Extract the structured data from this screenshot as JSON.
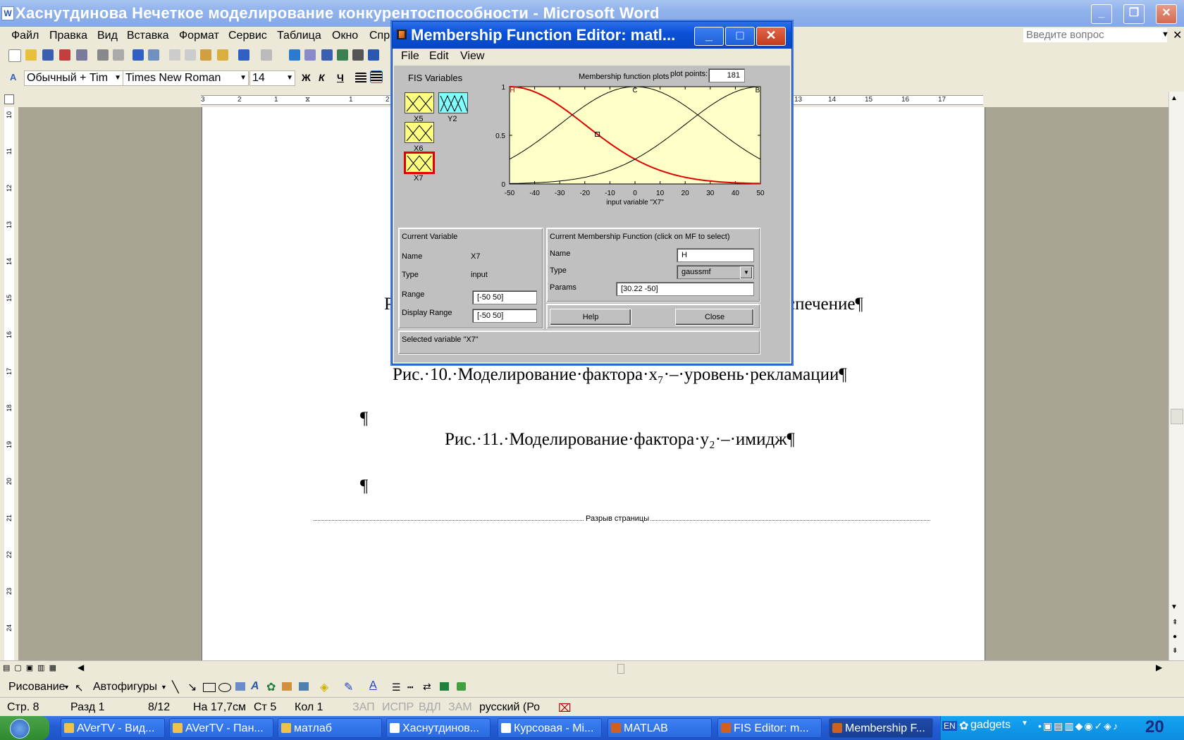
{
  "word": {
    "title": "Хаснутдинова Нечеткое моделирование конкурентоспособности - Microsoft Word",
    "menu": [
      "Файл",
      "Правка",
      "Вид",
      "Вставка",
      "Формат",
      "Сервис",
      "Таблица",
      "Окно",
      "Спра"
    ],
    "ask_placeholder": "Введите вопрос",
    "style_combo": "Обычный + Tim",
    "font_combo": "Times New Roman",
    "size_combo": "14",
    "bold": "Ж",
    "italic": "К",
    "underline": "Ч",
    "doc_lines": {
      "partial_left": "Р",
      "partial_right": "спечение¶",
      "caption10": "Рис.·10.·Моделирование·фактора·х₇·–·уровень·рекламации¶",
      "para1": "¶",
      "caption11": "Рис.·11.·Моделирование·фактора·у₂·–·имидж¶",
      "para2": "¶",
      "page_break": "Разрыв страницы"
    },
    "drawing_label": "Рисование",
    "autoshapes_label": "Автофигуры",
    "status": {
      "page": "Стр. 8",
      "section": "Разд 1",
      "pages": "8/12",
      "at": "На 17,7см",
      "line": "Ст 5",
      "col": "Кол 1",
      "rec": "ЗАП",
      "trk": "ИСПР",
      "ext": "ВДЛ",
      "ovr": "ЗАМ",
      "lang": "русский (Ро"
    },
    "ruler_numbers": [
      "3",
      "2",
      "1",
      "1",
      "2",
      "13",
      "14",
      "15",
      "16",
      "17"
    ],
    "vruler_numbers": [
      "10",
      "11",
      "12",
      "13",
      "14",
      "15",
      "16",
      "17",
      "18",
      "19",
      "20",
      "21",
      "22",
      "23",
      "24"
    ]
  },
  "matlab": {
    "title": "Membership Function Editor: matl...",
    "menu": [
      "File",
      "Edit",
      "View"
    ],
    "fis_variables_label": "FIS Variables",
    "variables": [
      {
        "name": "X5",
        "color": "#ffff80"
      },
      {
        "name": "Y2",
        "color": "#80ffff"
      },
      {
        "name": "X6",
        "color": "#ffff80"
      },
      {
        "name": "X7",
        "color": "#ffff80",
        "selected": true
      }
    ],
    "plot_label": "Membership function plots",
    "plot_points_label": "plot points:",
    "plot_points_value": "181",
    "current_variable": {
      "header": "Current Variable",
      "name_label": "Name",
      "name_value": "X7",
      "type_label": "Type",
      "type_value": "input",
      "range_label": "Range",
      "range_value": "[-50 50]",
      "display_range_label": "Display Range",
      "display_range_value": "[-50 50]"
    },
    "current_mf": {
      "header": "Current Membership Function (click on MF to select)",
      "name_label": "Name",
      "name_value": "H",
      "type_label": "Type",
      "type_value": "gaussmf",
      "params_label": "Params",
      "params_value": "[30.22 -50]"
    },
    "help_label": "Help",
    "close_label": "Close",
    "status_text": "Selected variable \"X7\""
  },
  "chart_data": {
    "type": "line",
    "xlabel": "input variable \"X7\"",
    "xlim": [
      -50,
      50
    ],
    "ylim": [
      0,
      1
    ],
    "xticks": [
      -50,
      -40,
      -30,
      -20,
      -10,
      0,
      10,
      20,
      30,
      40,
      50
    ],
    "yticks": [
      0,
      0.5,
      1
    ],
    "series": [
      {
        "name": "H",
        "mf": "gaussmf",
        "sigma": 30.22,
        "center": -50,
        "color": "#e00000",
        "selected": true
      },
      {
        "name": "C",
        "mf": "gaussmf",
        "sigma": 30.22,
        "center": 0,
        "color": "#000000"
      },
      {
        "name": "B",
        "mf": "gaussmf",
        "sigma": 30.22,
        "center": 50,
        "color": "#000000"
      }
    ],
    "marker_x": -15
  },
  "taskbar": {
    "tasks": [
      "AVerTV - Вид...",
      "AVerTV - Пан...",
      "матлаб",
      "Хаснутдинов...",
      "Курсовая - Mi...",
      "MATLAB",
      "FIS Editor: m...",
      "Membership F..."
    ],
    "tray_lang": "EN",
    "tray_gadgets": "gadgets",
    "clock": "20"
  }
}
